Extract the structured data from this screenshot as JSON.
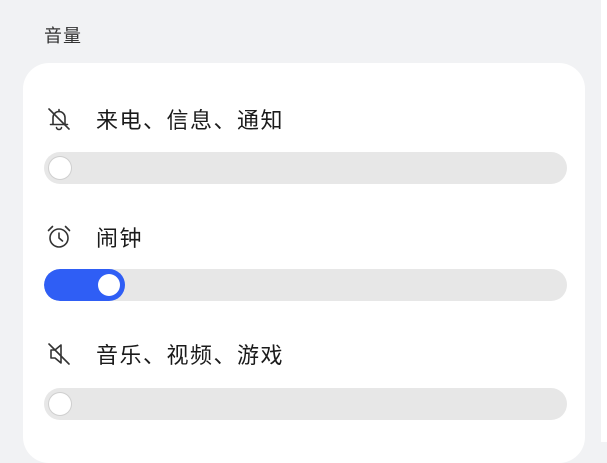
{
  "section": {
    "title": "音量"
  },
  "sliders": [
    {
      "label": "来电、信息、通知",
      "icon": "bell-muted-icon",
      "level": 0
    },
    {
      "label": "闹钟",
      "icon": "alarm-clock-icon",
      "level": 0.1
    },
    {
      "label": "音乐、视频、游戏",
      "icon": "speaker-muted-icon",
      "level": 0
    }
  ],
  "colors": {
    "accent": "#2f5ef5",
    "track": "#e7e7e7",
    "background": "#f1f2f4",
    "card": "#ffffff"
  }
}
